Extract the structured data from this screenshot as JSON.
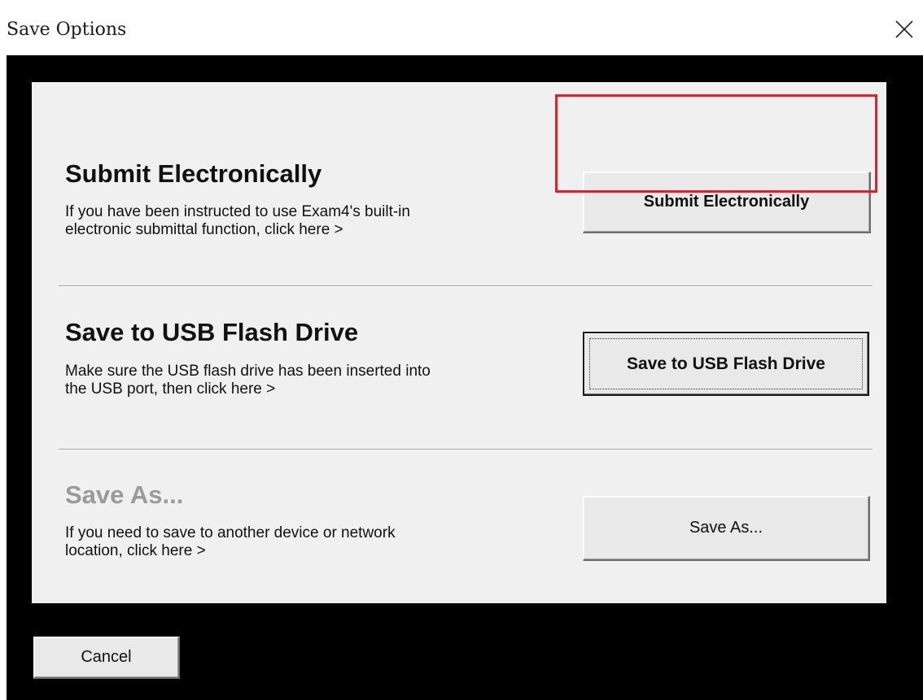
{
  "window": {
    "title": "Save Options",
    "close_glyph": "×"
  },
  "sections": [
    {
      "heading": "Submit Electronically",
      "description_lines": [
        "If you have been instructed to use Exam4's built-in",
        "electronic submittal function, click here >"
      ],
      "button_label": "Submit Electronically",
      "highlighted": true
    },
    {
      "heading": "Save to USB Flash Drive",
      "description_lines": [
        "Make sure the USB flash drive has been inserted into",
        "the USB port, then click here >"
      ],
      "button_label": "Save to USB Flash Drive",
      "focused": true
    },
    {
      "heading": "Save As...",
      "heading_disabled": true,
      "description_lines": [
        "If you need to save to another device or network",
        "location, click here >"
      ],
      "button_label": "Save As..."
    }
  ],
  "footer": {
    "cancel_label": "Cancel"
  },
  "colors": {
    "highlight_border": "#e0202a",
    "dialog_background": "#000000",
    "panel_background": "#f0f0f0",
    "disabled_heading": "#9a9a9a"
  },
  "icons": {
    "close": "close-icon"
  }
}
